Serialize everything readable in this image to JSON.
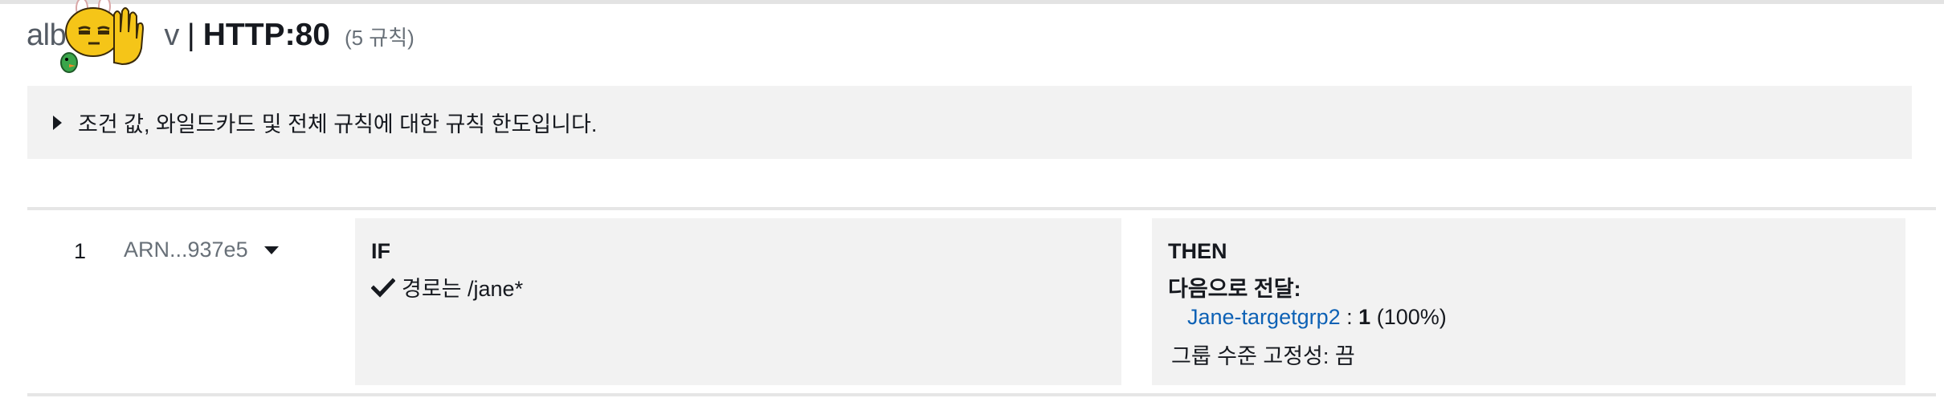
{
  "header": {
    "lb_name": "alb-",
    "lb_name_suffix": "v",
    "separator": "|",
    "listener": "HTTP:80",
    "rule_count": "(5 규칙)"
  },
  "info_box": {
    "text": "조건 값, 와일드카드 및 전체 규칙에 대한 규칙 한도입니다."
  },
  "rule": {
    "priority": "1",
    "arn": "ARN...937e5",
    "if_label": "IF",
    "condition": "경로는 /jane*",
    "then_label": "THEN",
    "action_title": "다음으로 전달:",
    "target_group": "Jane-targetgrp2",
    "weight_sep": ":",
    "weight": "1",
    "weight_percent": "(100%)",
    "stickiness": "그룹 수준 고정성: 끔"
  },
  "colors": {
    "link": "#0d61b5",
    "panel_bg": "#f2f2f2",
    "muted_text": "#687078"
  },
  "icons": {
    "condition": "check-icon",
    "expand": "caret-right-icon",
    "dropdown": "caret-down-icon",
    "sticker": "emoji-sticker"
  }
}
